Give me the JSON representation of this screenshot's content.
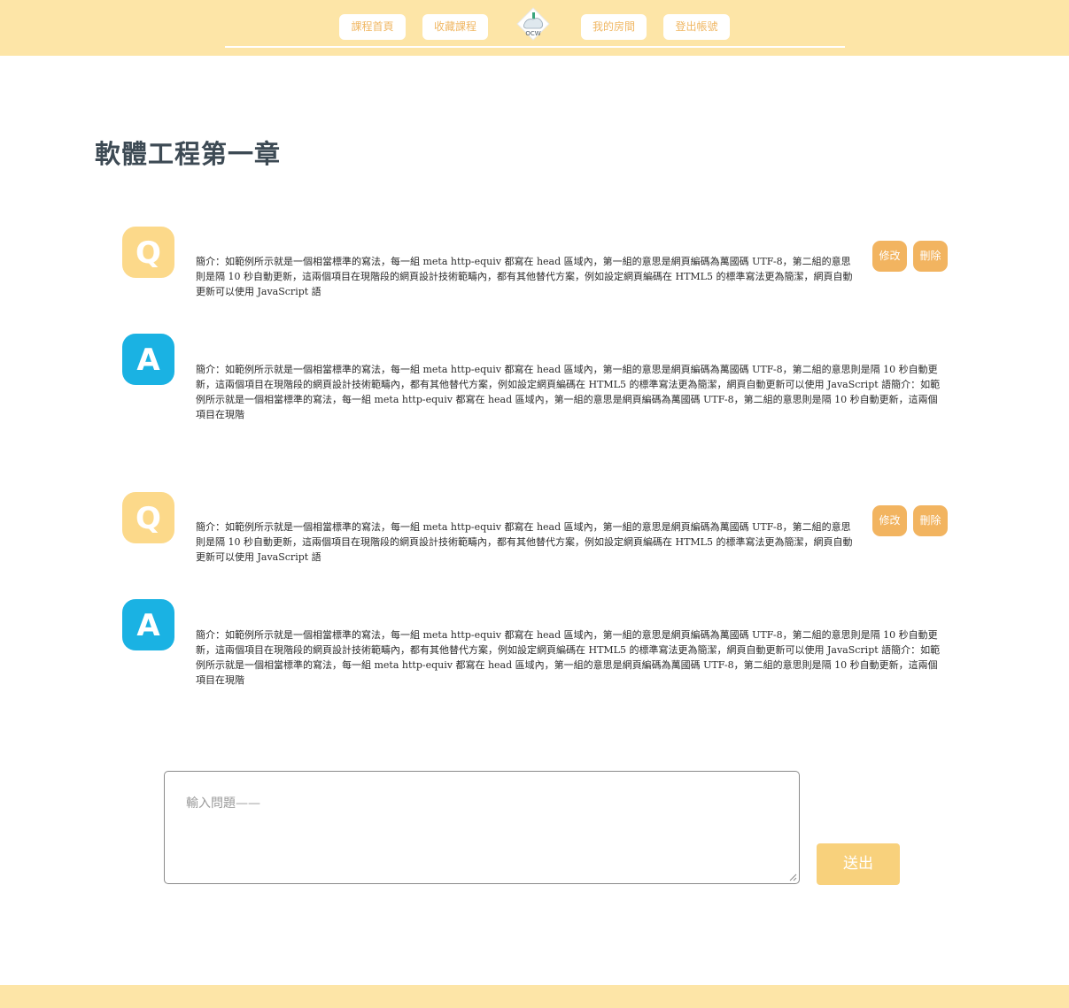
{
  "nav": {
    "home": "課程首頁",
    "favorites": "收藏課程",
    "logo_icon": "ocw-logo-icon",
    "logo_text": "OCW",
    "my_room": "我的房間",
    "logout": "登出帳號"
  },
  "page": {
    "title": "軟體工程第一章"
  },
  "qa": [
    {
      "q_icon": "Q",
      "question": "簡介：如範例所示就是一個相當標準的寫法，每一組 meta http-equiv 都寫在 head 區域內，第一組的意思是網頁編碼為萬國碼 UTF-8，第二組的意思則是隔 10 秒自動更新，這兩個項目在現階段的網頁設計技術範疇內，都有其他替代方案，例如設定網頁編碼在 HTML5 的標準寫法更為簡潔，網頁自動更新可以使用 JavaScript 語",
      "edit": "修改",
      "delete": "刪除",
      "a_icon": "A",
      "answer": "簡介：如範例所示就是一個相當標準的寫法，每一組 meta http-equiv 都寫在 head 區域內，第一組的意思是網頁編碼為萬國碼 UTF-8，第二組的意思則是隔 10 秒自動更新，這兩個項目在現階段的網頁設計技術範疇內，都有其他替代方案，例如設定網頁編碼在 HTML5 的標準寫法更為簡潔，網頁自動更新可以使用 JavaScript 語簡介：如範例所示就是一個相當標準的寫法，每一組 meta http-equiv 都寫在 head 區域內，第一組的意思是網頁編碼為萬國碼 UTF-8，第二組的意思則是隔 10 秒自動更新，這兩個項目在現階"
    },
    {
      "q_icon": "Q",
      "question": "簡介：如範例所示就是一個相當標準的寫法，每一組 meta http-equiv 都寫在 head 區域內，第一組的意思是網頁編碼為萬國碼 UTF-8，第二組的意思則是隔 10 秒自動更新，這兩個項目在現階段的網頁設計技術範疇內，都有其他替代方案，例如設定網頁編碼在 HTML5 的標準寫法更為簡潔，網頁自動更新可以使用 JavaScript 語",
      "edit": "修改",
      "delete": "刪除",
      "a_icon": "A",
      "answer": "簡介：如範例所示就是一個相當標準的寫法，每一組 meta http-equiv 都寫在 head 區域內，第一組的意思是網頁編碼為萬國碼 UTF-8，第二組的意思則是隔 10 秒自動更新，這兩個項目在現階段的網頁設計技術範疇內，都有其他替代方案，例如設定網頁編碼在 HTML5 的標準寫法更為簡潔，網頁自動更新可以使用 JavaScript 語簡介：如範例所示就是一個相當標準的寫法，每一組 meta http-equiv 都寫在 head 區域內，第一組的意思是網頁編碼為萬國碼 UTF-8，第二組的意思則是隔 10 秒自動更新，這兩個項目在現階"
    }
  ],
  "ask": {
    "placeholder": "輸入問題——",
    "send": "送出"
  },
  "colors": {
    "header_bg": "#fde5a7",
    "accent": "#f2b460",
    "question_avatar": "#fcd98a",
    "answer_avatar": "#1ab2e3"
  }
}
